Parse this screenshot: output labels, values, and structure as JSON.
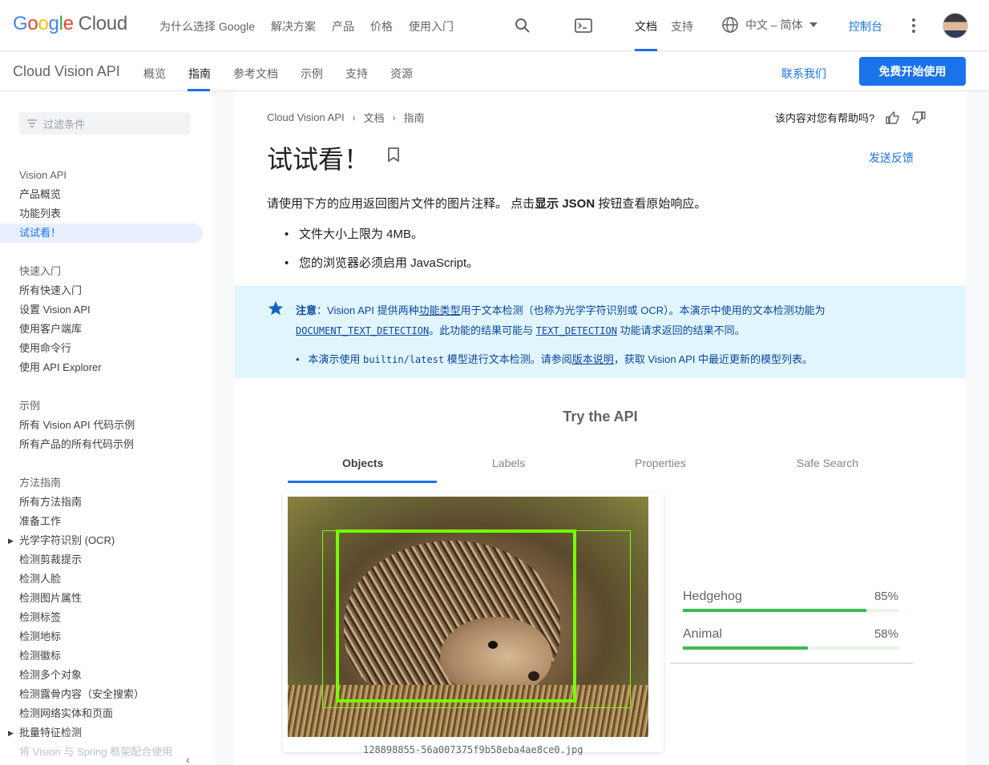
{
  "header": {
    "logo_google": [
      "G",
      "o",
      "o",
      "g",
      "l",
      "e"
    ],
    "logo_cloud": "Cloud",
    "nav": [
      "为什么选择 Google",
      "解决方案",
      "产品",
      "价格",
      "使用入门"
    ],
    "docs_tab": "文档",
    "support_tab": "支持",
    "language": "中文 – 简体",
    "console": "控制台",
    "icons": {
      "search": "search-icon",
      "terminal": "terminal-icon",
      "globe": "globe-icon",
      "more": "more-vert-icon"
    }
  },
  "subheader": {
    "product": "Cloud Vision API",
    "tabs": [
      "概览",
      "指南",
      "参考文档",
      "示例",
      "支持",
      "资源"
    ],
    "active_tab": "指南",
    "contact": "联系我们",
    "cta": "免费开始使用"
  },
  "sidebar": {
    "filter_placeholder": "过滤条件",
    "groups": [
      {
        "items": [
          {
            "label": "Vision API",
            "type": "header"
          },
          {
            "label": "产品概览"
          },
          {
            "label": "功能列表"
          },
          {
            "label": "试试看！",
            "active": true
          }
        ]
      },
      {
        "items": [
          {
            "label": "快速入门",
            "type": "header"
          },
          {
            "label": "所有快速入门"
          },
          {
            "label": "设置 Vision API"
          },
          {
            "label": "使用客户端库"
          },
          {
            "label": "使用命令行"
          },
          {
            "label": "使用 API Explorer"
          }
        ]
      },
      {
        "items": [
          {
            "label": "示例",
            "type": "header"
          },
          {
            "label": "所有 Vision API 代码示例"
          },
          {
            "label": "所有产品的所有代码示例"
          }
        ]
      },
      {
        "items": [
          {
            "label": "方法指南",
            "type": "header"
          },
          {
            "label": "所有方法指南"
          },
          {
            "label": "准备工作"
          },
          {
            "label": "光学字符识别 (OCR)",
            "caret": true
          },
          {
            "label": "检测剪裁提示"
          },
          {
            "label": "检测人脸"
          },
          {
            "label": "检测图片属性"
          },
          {
            "label": "检测标签"
          },
          {
            "label": "检测地标"
          },
          {
            "label": "检测徽标"
          },
          {
            "label": "检测多个对象"
          },
          {
            "label": "检测露骨内容（安全搜索）"
          },
          {
            "label": "检测网络实体和页面"
          },
          {
            "label": "批量特征检测",
            "caret": true
          },
          {
            "label": "将 Vision 与 Spring 框架配合使用",
            "faded": true
          }
        ]
      }
    ]
  },
  "main": {
    "breadcrumb": [
      "Cloud Vision API",
      "文档",
      "指南"
    ],
    "helpful": "该内容对您有帮助吗?",
    "title": "试试看！",
    "feedback": "发送反馈",
    "intro_pre": "请使用下方的应用返回图片文件的图片注释。 点击",
    "intro_bold": "显示 JSON",
    "intro_post": " 按钮查看原始响应。",
    "bullets": [
      "文件大小上限为 4MB。",
      "您的浏览器必须启用 JavaScript。"
    ],
    "note": {
      "label": "注意",
      "l1a": "：Vision API 提供两种",
      "l1link": "功能类型",
      "l1b": "用于文本检测（也称为光学字符识别或 OCR）。本演示中使用的文本检测功能为",
      "code1": "DOCUMENT_TEXT_DETECTION",
      "l2a": "。此功能的结果可能与 ",
      "code2": "TEXT_DETECTION",
      "l2b": " 功能请求返回的结果不同。",
      "b_pre": "本演示使用 ",
      "b_code": "builtin/latest",
      "b_mid": " 模型进行文本检测。请参阅",
      "b_link": "版本说明",
      "b_post": "，获取 Vision API 中最近更新的模型列表。"
    },
    "try_title": "Try the API",
    "tabs": [
      "Objects",
      "Labels",
      "Properties",
      "Safe Search"
    ],
    "active_tab": "Objects",
    "filename": "128898855-56a007375f9b58eba4ae8ce0.jpg",
    "results": [
      {
        "name": "Hedgehog",
        "pct": "85%",
        "value": 0.85
      },
      {
        "name": "Animal",
        "pct": "58%",
        "value": 0.58
      }
    ]
  },
  "colors": {
    "accent": "#1a73e8",
    "box": "#76ff03",
    "bar": "#3cba54",
    "note_bg": "#e1f5fe"
  }
}
